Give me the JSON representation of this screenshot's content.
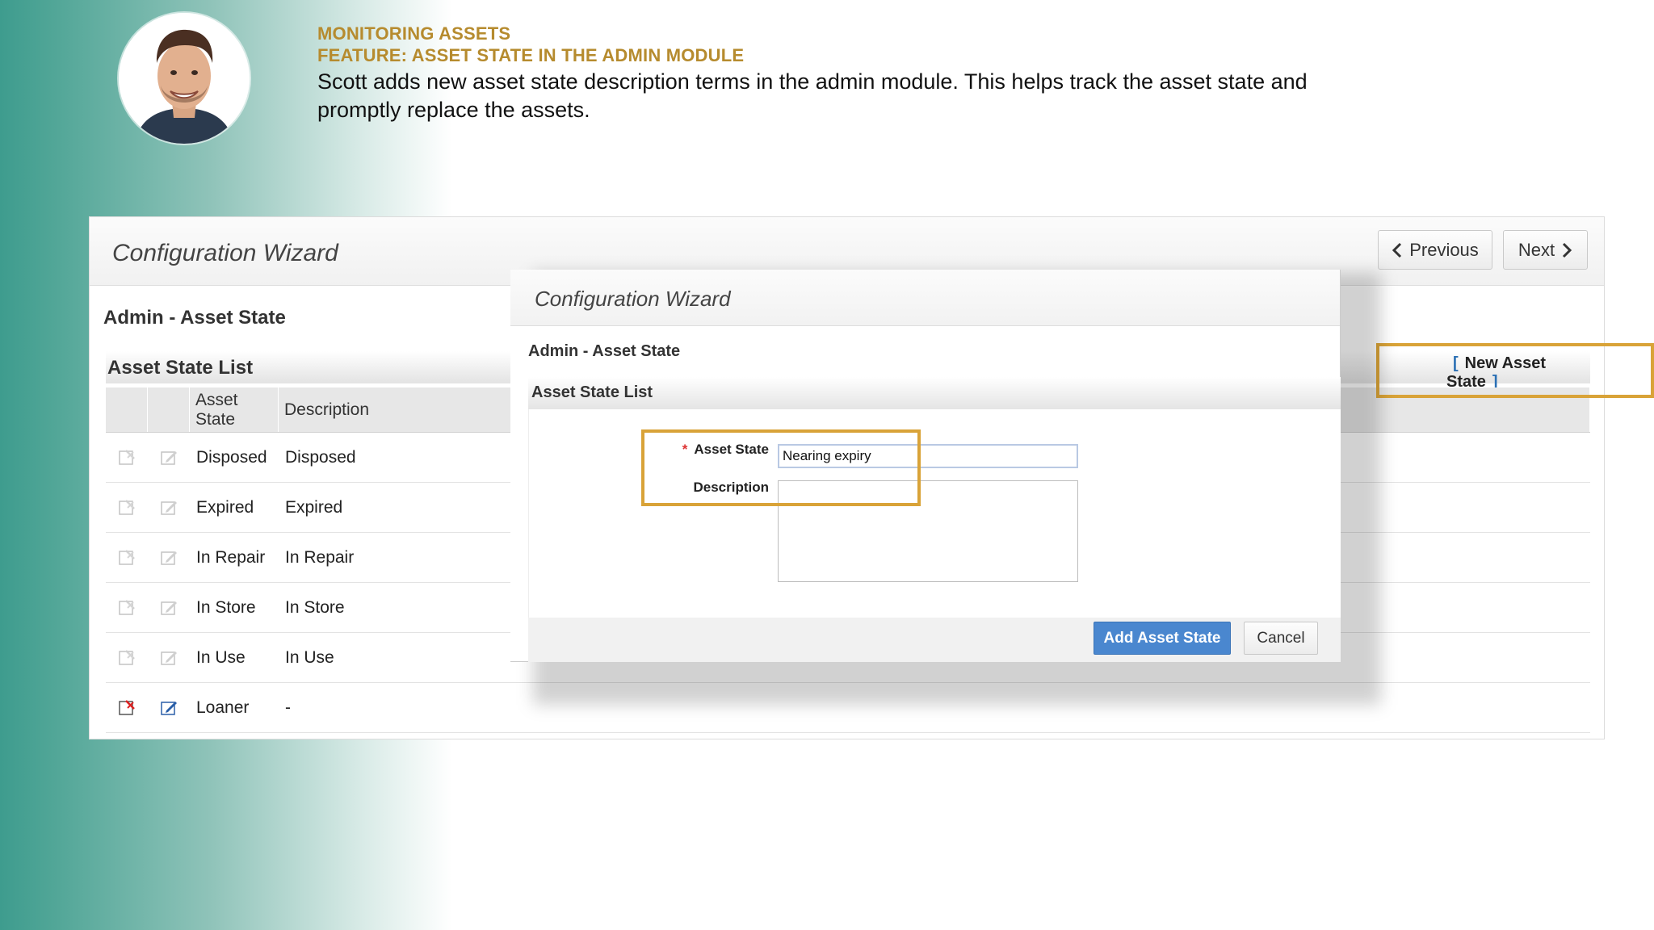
{
  "slide": {
    "kicker1": "MONITORING ASSETS",
    "kicker2": "FEATURE: ASSET STATE IN THE ADMIN MODULE",
    "body": "Scott adds new asset state description terms in the admin module. This helps track the asset state and promptly replace the assets."
  },
  "app": {
    "title": "Configuration Wizard",
    "previous_label": "Previous",
    "next_label": "Next",
    "section": "Admin - Asset State",
    "list_title": "Asset State List",
    "new_state_label": "New Asset State",
    "bracket_open": "[",
    "bracket_close": "]",
    "columns": {
      "state": "Asset State",
      "description": "Description"
    },
    "rows": [
      {
        "state": "Disposed",
        "description": "Disposed"
      },
      {
        "state": "Expired",
        "description": "Expired"
      },
      {
        "state": "In Repair",
        "description": "In Repair"
      },
      {
        "state": "In Store",
        "description": "In Store"
      },
      {
        "state": "In Use",
        "description": "In Use"
      },
      {
        "state": "Loaner",
        "description": "-"
      }
    ]
  },
  "modal": {
    "title": "Configuration Wizard",
    "section": "Admin - Asset State",
    "list_title": "Asset State List",
    "required_mark": "*",
    "asset_state_label": "Asset State",
    "asset_state_value": "Nearing expiry",
    "description_label": "Description",
    "description_value": "",
    "add_label": "Add Asset State",
    "cancel_label": "Cancel"
  },
  "colors": {
    "accent_gold": "#d9a338",
    "kicker": "#b68b2e",
    "primary_button": "#4a87cf"
  }
}
